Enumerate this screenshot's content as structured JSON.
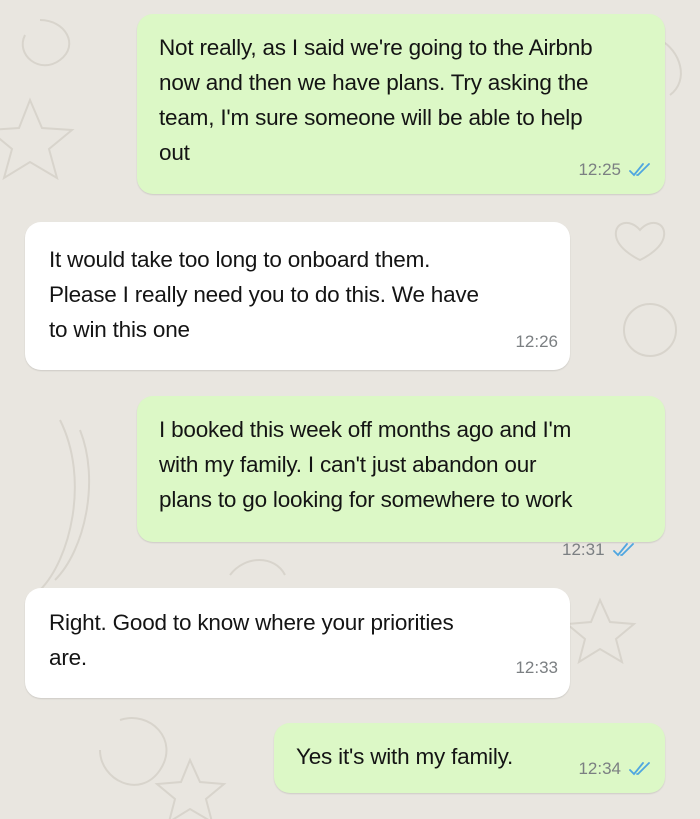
{
  "colors": {
    "background": "#e9e6e0",
    "outgoing_bubble": "#dcf8c6",
    "incoming_bubble": "#ffffff",
    "read_ticks": "#4fa6e0",
    "timestamp": "#7b7f82"
  },
  "messages": [
    {
      "direction": "outgoing",
      "text": "Not really, as I said we're going to the Airbnb\nnow and then we have plans. Try asking the\nteam, I'm sure someone will be able to help\nout",
      "time": "12:25",
      "status_icon": "double-check-read-icon"
    },
    {
      "direction": "incoming",
      "text": "It would take too long to onboard them.\nPlease I really need you to do this. We have\nto win this one",
      "time": "12:26"
    },
    {
      "direction": "outgoing",
      "text": "I booked this week off months ago and I'm\nwith my family. I can't just abandon our\nplans to go looking for somewhere to work",
      "time": "12:31",
      "status_icon": "double-check-read-icon"
    },
    {
      "direction": "incoming",
      "text": "Right. Good to know where your priorities\nare.",
      "time": "12:33"
    },
    {
      "direction": "outgoing",
      "text": "Yes it's with my family.",
      "time": "12:34",
      "status_icon": "double-check-read-icon"
    }
  ]
}
